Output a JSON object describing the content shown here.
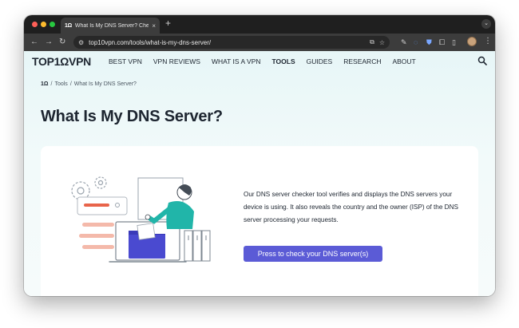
{
  "browser": {
    "tab": {
      "favicon_text": "1Ω",
      "title": "What Is My DNS Server? Chec",
      "close": "×"
    },
    "new_tab": "+",
    "tab_dropdown": "⌄",
    "nav": {
      "back": "←",
      "forward": "→",
      "reload": "↻"
    },
    "url": "top10vpn.com/tools/what-is-my-dns-server/",
    "icons": [
      "site-settings-icon",
      "cast-icon",
      "bookmark-star-icon",
      "extension-icons",
      "avatar-icon",
      "kebab-menu-icon"
    ]
  },
  "site": {
    "logo": "TOP1ΩVPN",
    "nav_items": [
      {
        "label": "BEST VPN",
        "active": false
      },
      {
        "label": "VPN REVIEWS",
        "active": false
      },
      {
        "label": "WHAT IS A VPN",
        "active": false
      },
      {
        "label": "TOOLS",
        "active": true
      },
      {
        "label": "GUIDES",
        "active": false
      },
      {
        "label": "RESEARCH",
        "active": false
      },
      {
        "label": "ABOUT",
        "active": false
      }
    ]
  },
  "breadcrumb": {
    "home": "1Ω",
    "sep": "/",
    "tools": "Tools",
    "current": "What Is My DNS Server?"
  },
  "page_title": "What Is My DNS Server?",
  "description": "Our DNS server checker tool verifies and displays the DNS servers your device is using. It also reveals the country and the owner (ISP) of the DNS server processing your requests.",
  "cta_label": "Press to check your DNS server(s)",
  "colors": {
    "accent": "#5b5bd6",
    "teal": "#21b5a9",
    "coral": "#e8644a",
    "folder": "#4a4ad0"
  }
}
